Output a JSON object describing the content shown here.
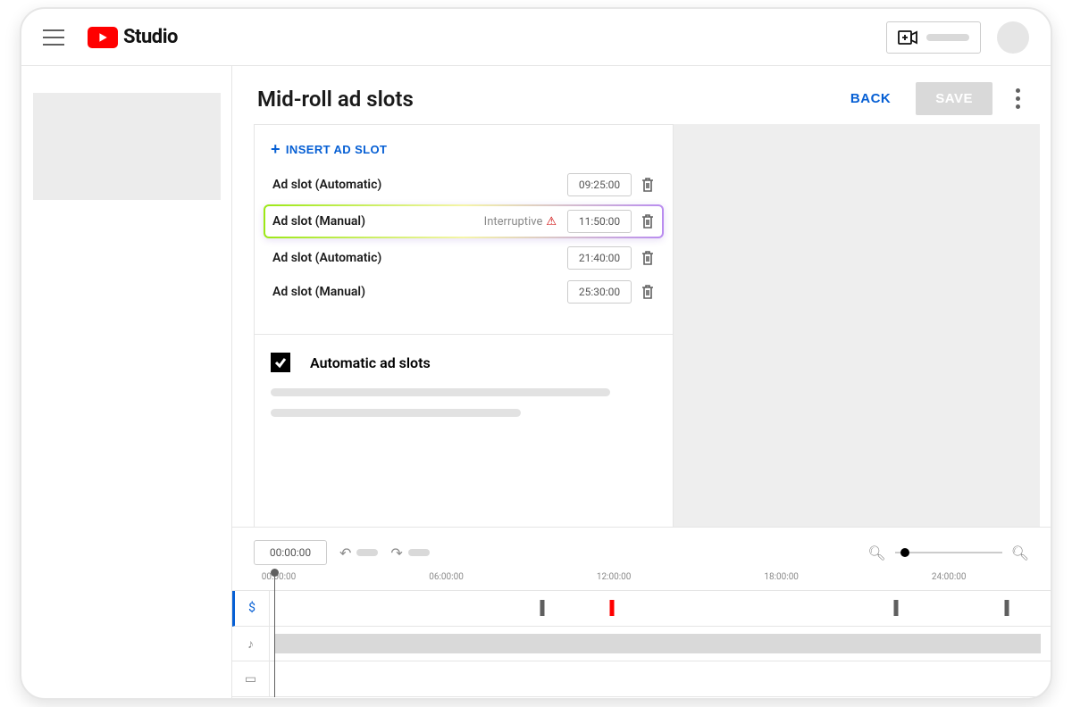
{
  "header": {
    "logo_text": "Studio"
  },
  "titlebar": {
    "title": "Mid-roll ad slots",
    "back_label": "BACK",
    "save_label": "SAVE"
  },
  "insert_label": "INSERT AD SLOT",
  "slots": [
    {
      "name": "Ad slot (Automatic)",
      "tag": "",
      "time": "09:25:00",
      "highlighted": false
    },
    {
      "name": "Ad slot (Manual)",
      "tag": "Interruptive",
      "time": "11:50:00",
      "highlighted": true
    },
    {
      "name": "Ad slot (Automatic)",
      "tag": "",
      "time": "21:40:00",
      "highlighted": false
    },
    {
      "name": "Ad slot (Manual)",
      "tag": "",
      "time": "25:30:00",
      "highlighted": false
    }
  ],
  "auto": {
    "checked": true,
    "label": "Automatic ad slots"
  },
  "timeline": {
    "current": "00:00:00",
    "duration_minutes": 1620,
    "ticks": [
      "00:00:00",
      "06:00:00",
      "12:00:00",
      "18:00:00",
      "24:00:00"
    ],
    "markers_minutes": [
      565,
      710,
      1300,
      1530
    ],
    "red_marker_index": 1,
    "playhead_minutes": 10,
    "clip": {
      "start_minutes": 10,
      "end_minutes": 1600
    }
  }
}
